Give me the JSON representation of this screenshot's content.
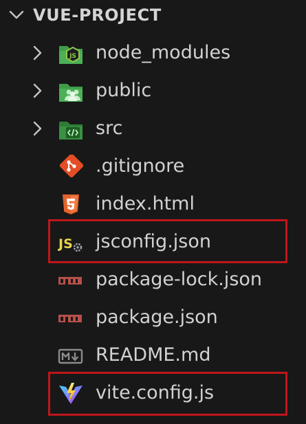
{
  "explorer": {
    "section_title": "VUE-PROJECT",
    "items": [
      {
        "label": "node_modules",
        "kind": "folder",
        "icon": "node-folder-icon"
      },
      {
        "label": "public",
        "kind": "folder",
        "icon": "public-folder-icon"
      },
      {
        "label": "src",
        "kind": "folder",
        "icon": "src-folder-icon"
      },
      {
        "label": ".gitignore",
        "kind": "file",
        "icon": "git-icon"
      },
      {
        "label": "index.html",
        "kind": "file",
        "icon": "html5-icon"
      },
      {
        "label": "jsconfig.json",
        "kind": "file",
        "icon": "jsconfig-icon",
        "highlighted": true
      },
      {
        "label": "package-lock.json",
        "kind": "file",
        "icon": "npm-icon"
      },
      {
        "label": "package.json",
        "kind": "file",
        "icon": "npm-icon"
      },
      {
        "label": "README.md",
        "kind": "file",
        "icon": "markdown-icon"
      },
      {
        "label": "vite.config.js",
        "kind": "file",
        "icon": "vite-icon",
        "highlighted": true
      }
    ]
  },
  "colors": {
    "background": "#181818",
    "text": "#cccccc",
    "highlight_border": "#c0161a",
    "folder_green": "#3f9d49",
    "git_orange": "#e44d26",
    "html_orange": "#e4642d",
    "js_yellow": "#e8d44d",
    "npm_red": "#b8504a",
    "vite_purple": "#a560f8"
  }
}
